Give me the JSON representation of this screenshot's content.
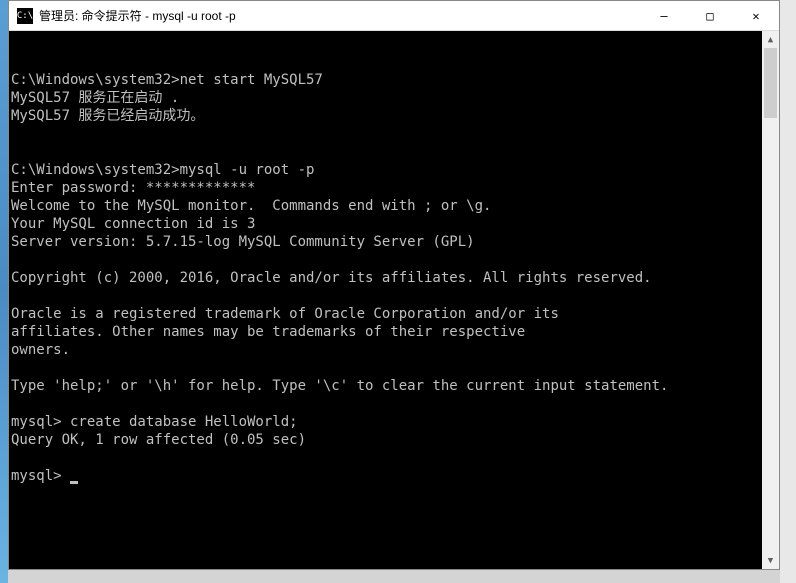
{
  "window": {
    "title": "管理员: 命令提示符 - mysql  -u root -p",
    "icon_label": "C:\\"
  },
  "controls": {
    "minimize": "—",
    "maximize": "□",
    "close": "✕"
  },
  "terminal": {
    "lines": [
      "",
      "",
      "C:\\Windows\\system32>net start MySQL57",
      "MySQL57 服务正在启动 .",
      "MySQL57 服务已经启动成功。",
      "",
      "",
      "C:\\Windows\\system32>mysql -u root -p",
      "Enter password: *************",
      "Welcome to the MySQL monitor.  Commands end with ; or \\g.",
      "Your MySQL connection id is 3",
      "Server version: 5.7.15-log MySQL Community Server (GPL)",
      "",
      "Copyright (c) 2000, 2016, Oracle and/or its affiliates. All rights reserved.",
      "",
      "Oracle is a registered trademark of Oracle Corporation and/or its",
      "affiliates. Other names may be trademarks of their respective",
      "owners.",
      "",
      "Type 'help;' or '\\h' for help. Type '\\c' to clear the current input statement.",
      "",
      "mysql> create database HelloWorld;",
      "Query OK, 1 row affected (0.05 sec)",
      "",
      "mysql> "
    ]
  }
}
